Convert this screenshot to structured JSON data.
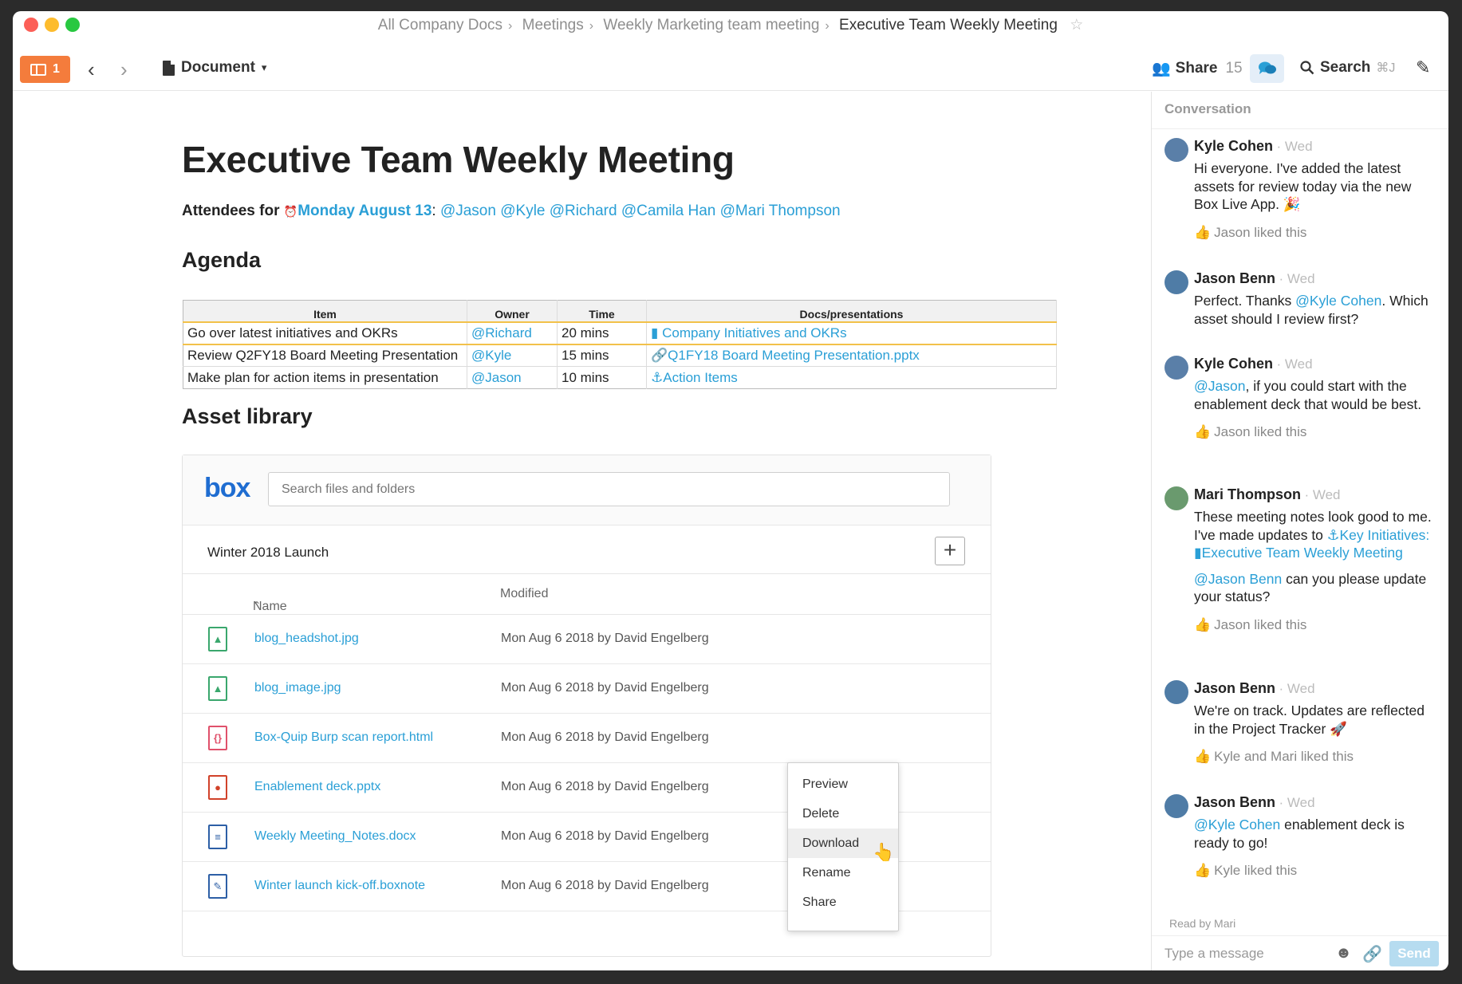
{
  "breadcrumb": [
    "All Company Docs",
    "Meetings",
    "Weekly Marketing team meeting",
    "Executive Team Weekly Meeting"
  ],
  "toolbar": {
    "badge_count": "1",
    "document_menu": "Document",
    "share_label": "Share",
    "share_count": "15",
    "search_label": "Search",
    "search_shortcut": "⌘J"
  },
  "doc": {
    "title": "Executive Team Weekly Meeting",
    "attendees_label": "Attendees for",
    "attendees_date": "Monday August 13",
    "attendees": [
      "@Jason",
      "@Kyle",
      "@Richard",
      "@Camila Han",
      "@Mari Thompson"
    ],
    "agenda_heading": "Agenda",
    "asset_heading": "Asset library"
  },
  "agenda": {
    "headers": [
      "Item",
      "Owner",
      "Time",
      "Docs/presentations"
    ],
    "rows": [
      {
        "item": "Go over latest initiatives and OKRs",
        "owner": "@Richard",
        "time": "20 mins",
        "doc": "Company Initiatives and OKRs",
        "doc_icon": "document-icon"
      },
      {
        "item": "Review Q2FY18 Board Meeting Presentation",
        "owner": "@Kyle",
        "time": "15 mins",
        "doc": "Q1FY18 Board Meeting Presentation.pptx",
        "doc_icon": "link-icon"
      },
      {
        "item": "Make plan for action items in presentation",
        "owner": "@Jason",
        "time": "10 mins",
        "doc": "Action Items",
        "doc_icon": "anchor-icon"
      }
    ]
  },
  "box": {
    "logo": "box",
    "search_placeholder": "Search files and folders",
    "folder": "Winter 2018 Launch",
    "col_name": "Name",
    "col_modified": "Modified",
    "files": [
      {
        "name": "blog_headshot.jpg",
        "modified": "Mon Aug 6 2018 by David Engelberg",
        "type": "image",
        "color": "#3aa76d"
      },
      {
        "name": "blog_image.jpg",
        "modified": "Mon Aug 6 2018 by David Engelberg",
        "type": "image",
        "color": "#3aa76d"
      },
      {
        "name": "Box-Quip Burp scan report.html",
        "modified": "Mon Aug 6 2018 by David Engelberg",
        "type": "code",
        "color": "#e0516b"
      },
      {
        "name": "Enablement deck.pptx",
        "modified": "Mon Aug 6 2018 by David Engelberg",
        "type": "presentation",
        "color": "#d1422a"
      },
      {
        "name": "Weekly Meeting_Notes.docx",
        "modified": "Mon Aug 6 2018 by David Engelberg",
        "type": "word",
        "color": "#2d5fa6"
      },
      {
        "name": "Winter launch kick-off.boxnote",
        "modified": "Mon Aug 6 2018 by David Engelberg",
        "type": "boxnote",
        "color": "#2d5fa6"
      }
    ]
  },
  "context_menu": [
    "Preview",
    "Delete",
    "Download",
    "Rename",
    "Share"
  ],
  "conversation": {
    "heading": "Conversation",
    "messages": [
      {
        "author": "Kyle Cohen",
        "when": "Wed",
        "text": "Hi everyone. I've added the latest assets for review today via the new Box Live App. 🎉",
        "liked": "Jason liked this"
      },
      {
        "author": "Jason Benn",
        "when": "Wed",
        "text": "Perfect. Thanks @Kyle Cohen. Which asset should I review first?",
        "liked": ""
      },
      {
        "author": "Kyle Cohen",
        "when": "Wed",
        "text": "@Jason, if you could start with the enablement deck that would be best.",
        "liked": "Jason liked this"
      },
      {
        "author": "Mari Thompson",
        "when": "Wed",
        "text": "These meeting notes look good to me. I've made updates to ⚓Key Initiatives: ▮Executive Team Weekly Meeting",
        "text2": "@Jason Benn can you please update your status?",
        "liked": "Jason liked this"
      },
      {
        "author": "Jason Benn",
        "when": "Wed",
        "text": "We're on track. Updates are reflected in the Project Tracker 🚀",
        "liked": "Kyle and Mari liked this"
      },
      {
        "author": "Jason Benn",
        "when": "Wed",
        "text": "@Kyle Cohen enablement deck is ready to go!",
        "liked": "Kyle liked this"
      }
    ],
    "read_by": "Read by Mari",
    "input_placeholder": "Type a message",
    "send_label": "Send"
  },
  "colors": {
    "accent": "#2a9fd6",
    "badge": "#f47c3c",
    "link": "#2a9fd6"
  }
}
